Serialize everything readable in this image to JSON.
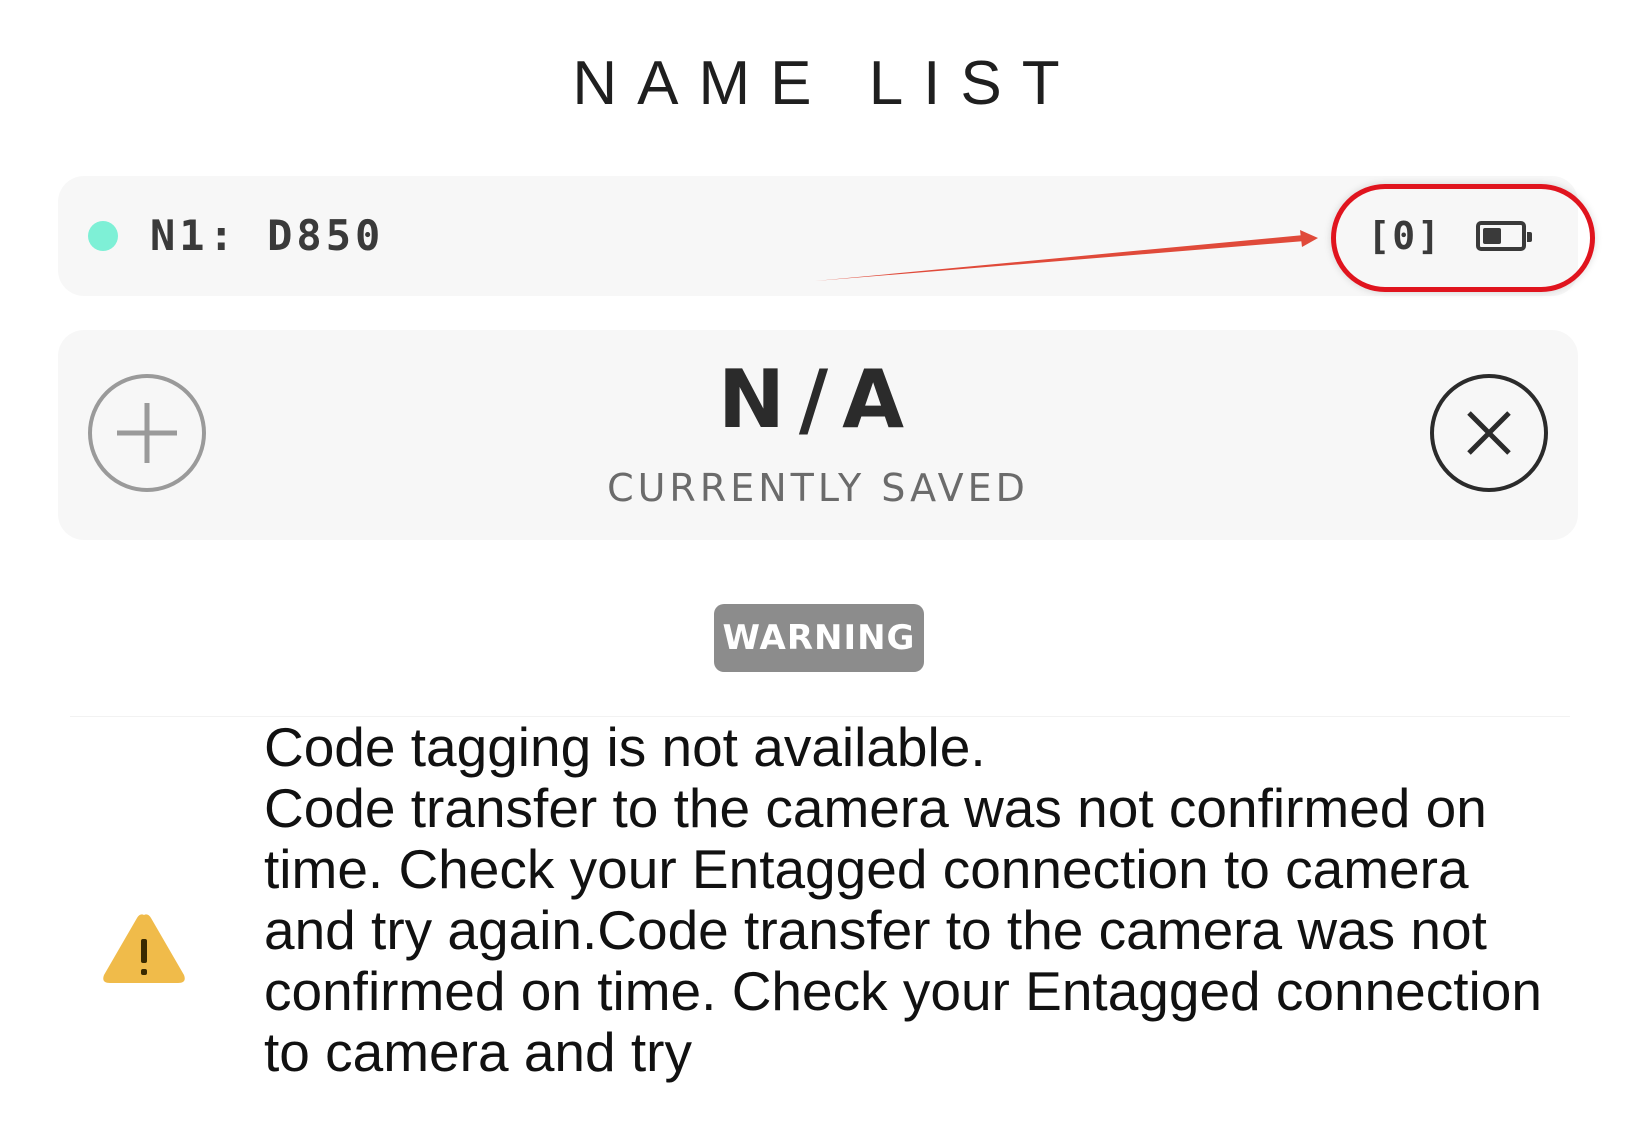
{
  "header": {
    "title": "NAME LIST"
  },
  "device": {
    "name": "N1: D850",
    "status_color": "#7ef0d6",
    "count": "[0]",
    "battery_level": 0.5,
    "battery_icon": "battery-icon"
  },
  "saved": {
    "value": "N/A",
    "label": "CURRENTLY SAVED",
    "add_icon": "plus-circle-icon",
    "remove_icon": "close-circle-icon"
  },
  "warning": {
    "badge": "WARNING",
    "icon": "warning-triangle-icon",
    "icon_color": "#f0bb4a",
    "message": "Code tagging is not available.\nCode transfer to the camera was not confirmed on time.  Check your Entagged connection to camera and try again.Code transfer to the camera was not confirmed on time.  Check your Entagged connection to camera and try"
  },
  "annotation": {
    "color": "#e0141e"
  }
}
